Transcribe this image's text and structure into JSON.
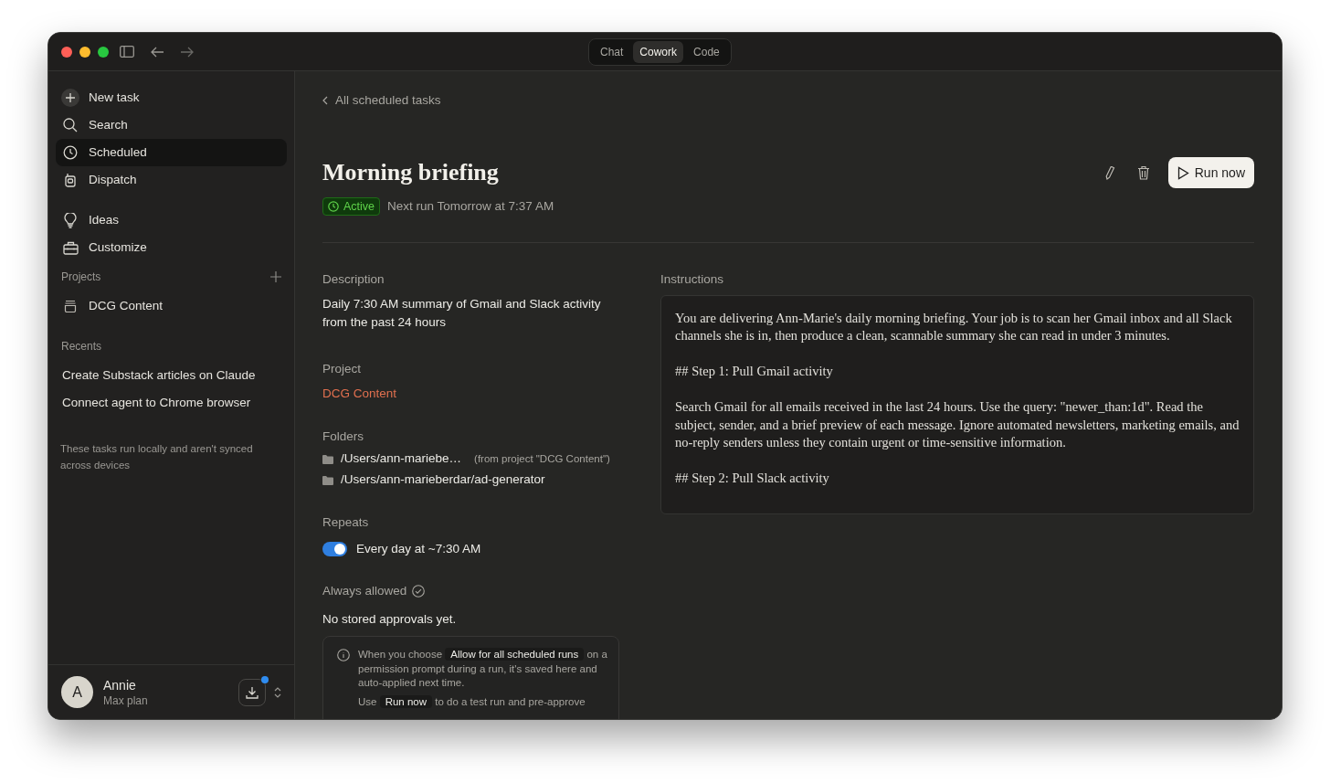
{
  "tabs": [
    {
      "label": "Chat",
      "selected": false
    },
    {
      "label": "Cowork",
      "selected": true
    },
    {
      "label": "Code",
      "selected": false
    }
  ],
  "sidebar": {
    "nav": [
      {
        "label": "New task",
        "selected": false
      },
      {
        "label": "Search",
        "selected": false
      },
      {
        "label": "Scheduled",
        "selected": true
      },
      {
        "label": "Dispatch",
        "selected": false
      }
    ],
    "nav2": [
      {
        "label": "Ideas",
        "selected": false
      },
      {
        "label": "Customize",
        "selected": false
      }
    ],
    "projects_label": "Projects",
    "projects": [
      {
        "label": "DCG Content"
      }
    ],
    "recents_label": "Recents",
    "recents": [
      "Create Substack articles on Claude",
      "Connect agent to Chrome browser"
    ],
    "note": "These tasks run locally and aren't synced across devices",
    "user": {
      "avatar": "A",
      "name": "Annie",
      "plan": "Max plan",
      "update_available": true
    }
  },
  "back_link": "All scheduled tasks",
  "task": {
    "title": "Morning briefing",
    "status": "Active",
    "active": true,
    "next_run": "Next run Tomorrow at 7:37 AM",
    "run_button": "Run now",
    "description_label": "Description",
    "description": "Daily 7:30 AM summary of Gmail and Slack activity from the past 24 hours",
    "project_label": "Project",
    "project": "DCG Content",
    "folders_label": "Folders",
    "folders": [
      {
        "path": "/Users/ann-mariebe…",
        "note": "(from project \"DCG Content\")"
      },
      {
        "path": "/Users/ann-marieberdar/ad-generator"
      }
    ],
    "repeats_label": "Repeats",
    "repeats": {
      "on": true,
      "text": "Every day at ~7:30 AM"
    },
    "allowed_label": "Always allowed",
    "allowed_empty": "No stored approvals yet.",
    "info": [
      [
        {
          "kind": "text",
          "text": "When you choose "
        },
        {
          "kind": "chip",
          "text": "Allow for all scheduled runs"
        },
        {
          "kind": "text",
          "text": " on a permission prompt during a run, it's saved here and auto-applied next time."
        }
      ],
      [
        {
          "kind": "text",
          "text": "Use "
        },
        {
          "kind": "chip",
          "text": "Run now"
        },
        {
          "kind": "text",
          "text": " to do a test run and pre-approve"
        }
      ]
    ],
    "instructions_label": "Instructions",
    "instructions": [
      "You are delivering Ann-Marie's daily morning briefing. Your job is to scan her Gmail inbox and all Slack channels she is in, then produce a clean, scannable summary she can read in under 3 minutes.",
      "## Step 1: Pull Gmail activity",
      "Search Gmail for all emails received in the last 24 hours. Use the query: \"newer_than:1d\". Read the subject, sender, and a brief preview of each message. Ignore automated newsletters, marketing emails, and no-reply senders unless they contain urgent or time-sensitive information.",
      "## Step 2: Pull Slack activity"
    ]
  }
}
